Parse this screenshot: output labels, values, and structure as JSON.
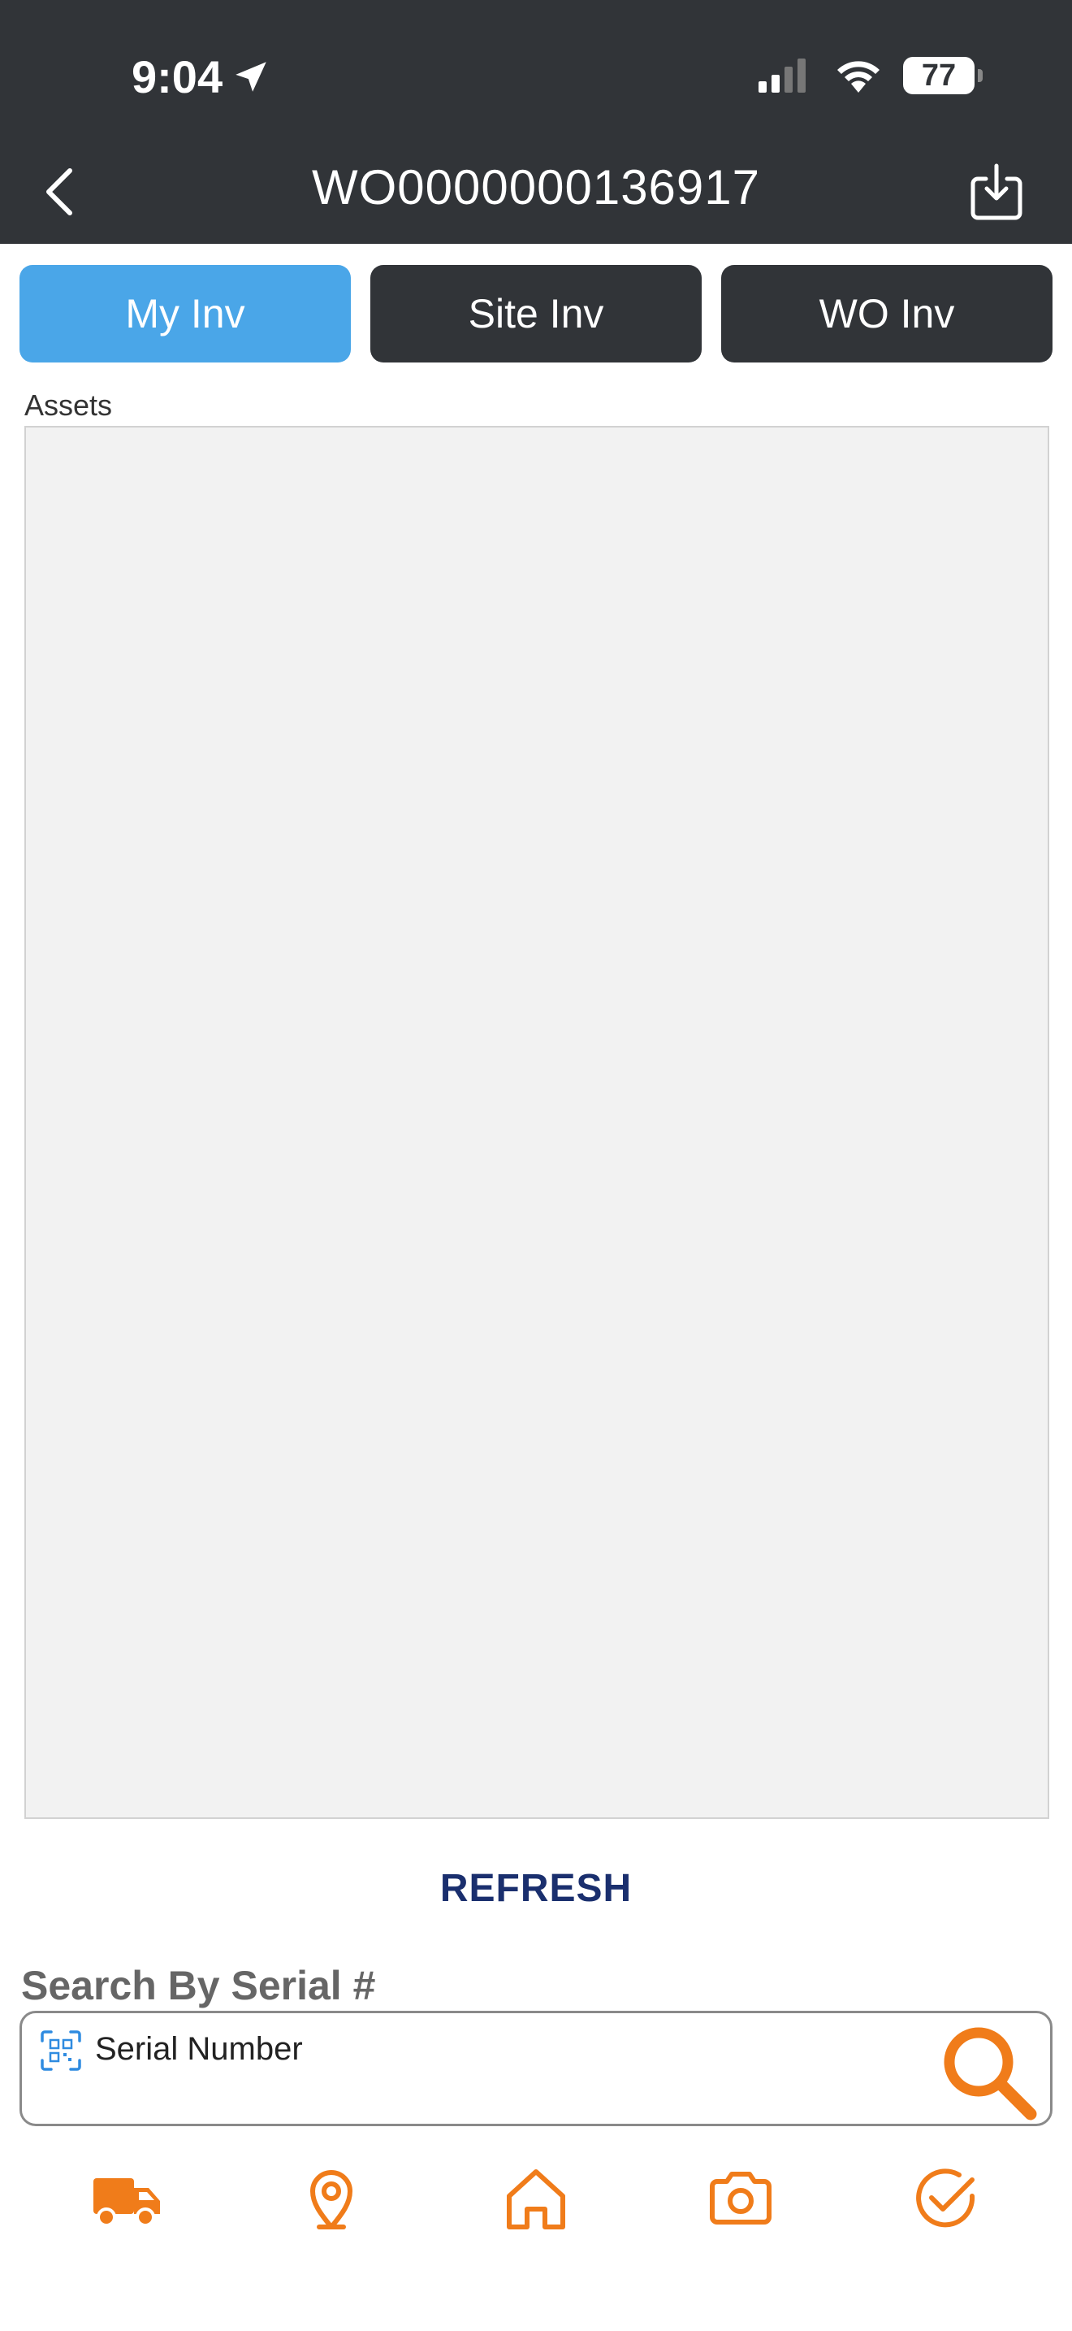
{
  "status": {
    "time": "9:04",
    "battery": "77"
  },
  "header": {
    "title": "WO0000000136917"
  },
  "tabs": [
    {
      "label": "My Inv",
      "active": true
    },
    {
      "label": "Site Inv",
      "active": false
    },
    {
      "label": "WO Inv",
      "active": false
    }
  ],
  "assets": {
    "label": "Assets"
  },
  "refresh_label": "REFRESH",
  "search": {
    "label": "Search By Serial #",
    "placeholder": "Serial Number"
  },
  "nav": [
    {
      "icon": "truck-icon"
    },
    {
      "icon": "location-pin-icon"
    },
    {
      "icon": "home-icon"
    },
    {
      "icon": "camera-icon"
    },
    {
      "icon": "check-circle-icon"
    }
  ],
  "colors": {
    "header_bg": "#313438",
    "tab_active": "#4aa6e8",
    "accent_orange": "#f07c1a",
    "refresh_text": "#1a2f6e"
  }
}
